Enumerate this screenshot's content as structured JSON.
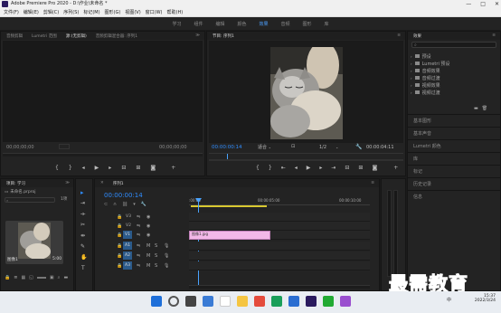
{
  "app": {
    "title": "Adobe Premiere Pro 2020 - D:\\作业\\未命名 *",
    "win_buttons": [
      "—",
      "□",
      "✕"
    ]
  },
  "menu": [
    "文件(F)",
    "编辑(E)",
    "剪辑(C)",
    "序列(S)",
    "标记(M)",
    "图形(G)",
    "视图(V)",
    "窗口(W)",
    "帮助(H)"
  ],
  "workspaces": {
    "items": [
      "学习",
      "组件",
      "编辑",
      "颜色",
      "效果",
      "音频",
      "图形",
      "库"
    ],
    "active_index": 4
  },
  "source_monitor": {
    "tabs": [
      "音频剪辑",
      "Lumetri 范围",
      "源:(无剪辑)",
      "音频剪辑混合器: 序列1"
    ],
    "active_tab": 2,
    "timecode_left": "00;00;00;00",
    "timecode_right": "00;00;00;00"
  },
  "program_monitor": {
    "tab": "节目: 序列1",
    "timecode_left": "00:00:00:14",
    "fit": "适合",
    "ratio": "1/2",
    "timecode_right": "00:00:04:11"
  },
  "effects_panel": {
    "title": "效果",
    "tree": [
      "预设",
      "Lumetri 预设",
      "音频效果",
      "音频过渡",
      "视频效果",
      "视频过渡"
    ],
    "sections": [
      "基本图形",
      "基本声音",
      "Lumetri 颜色",
      "库",
      "标记",
      "历史记录",
      "信息"
    ]
  },
  "project_panel": {
    "tab": "项目: 学习",
    "filename": "未命名.prproj",
    "media_count": "1项",
    "clip_name": "图像1",
    "clip_duration": "5:00"
  },
  "timeline": {
    "tab": "序列1",
    "timecode": "00:00:00:14",
    "ruler": [
      ":00:00",
      "00:00:05:00",
      "00:00:10:00"
    ],
    "video_tracks": [
      "V3",
      "V2",
      "V1"
    ],
    "audio_tracks": [
      "A1",
      "A2",
      "A3"
    ],
    "clip_label": "图像1.jpg",
    "meter_db": "dB"
  },
  "watermark": {
    "text": "最需教育"
  },
  "taskbar": {
    "time": "15:37",
    "date": "2022/3/24",
    "lang": "中"
  },
  "colors": {
    "accent": "#2f8dff",
    "clip": "#f2b8e8",
    "playhead": "#4aa3ff",
    "panel": "#232323"
  }
}
